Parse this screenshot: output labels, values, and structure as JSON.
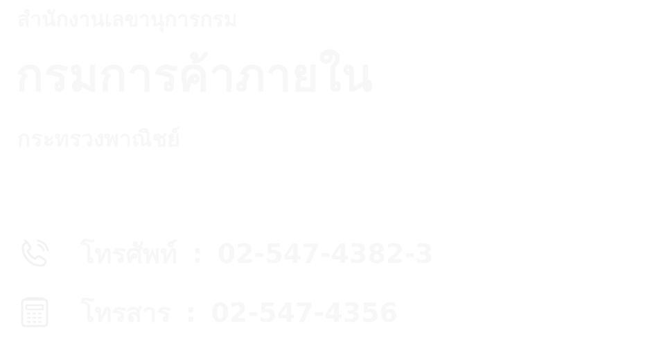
{
  "header": {
    "office_name": "สำนักงานเลขานุการกรม",
    "department_name": "กรมการค้าภายใน",
    "ministry_name": "กระทรวงพาณิชย์"
  },
  "contacts": {
    "phone": {
      "label": "โทรศัพท์",
      "separator": ":",
      "value": "02-547-4382-3"
    },
    "fax": {
      "label": "โทรสาร",
      "separator": ":",
      "value": "02-547-4356"
    }
  },
  "icons": {
    "phone": "phone-icon",
    "fax": "fax-icon"
  },
  "colors": {
    "background": "#ffffff",
    "text": "#f7f7f7",
    "icon": "#f2f2f2"
  }
}
